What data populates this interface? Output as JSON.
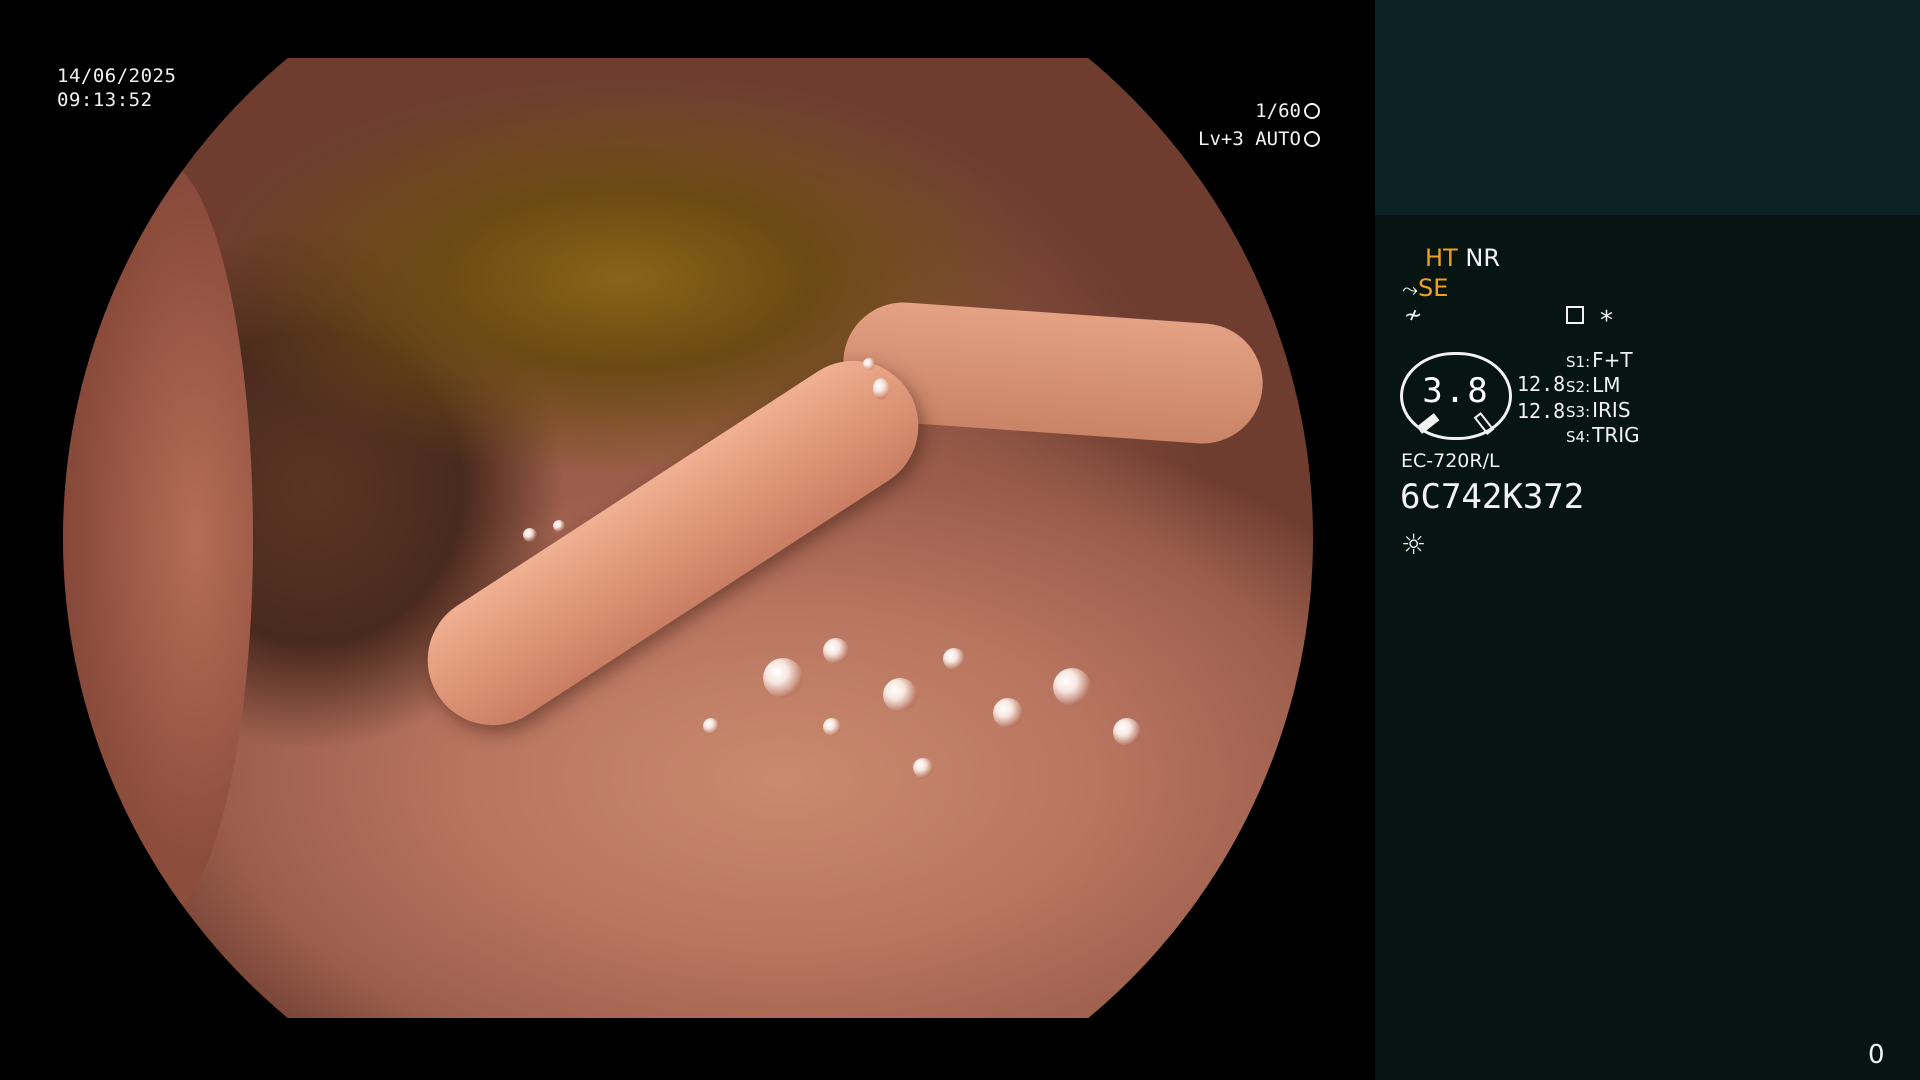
{
  "left": {
    "date": "14/06/2025",
    "time": "09:13:52",
    "shutter": "1/60",
    "exposure": "Lv+3 AUTO",
    "shutter_icon": "shutter-icon",
    "auto_icon": "auto-exposure-icon"
  },
  "panel": {
    "mode_ht": "HT",
    "mode_nr": "NR",
    "se_label": "SE",
    "se_icon": "scope-icon",
    "enhance_icon": "enhance-icon",
    "menu_icon": "menu-icon",
    "star": "*",
    "gauge_value": "3.8",
    "side_values": [
      "12.8",
      "12.8"
    ],
    "settings": [
      {
        "key": "S1:",
        "value": "F+T"
      },
      {
        "key": "S2:",
        "value": "LM"
      },
      {
        "key": "S3:",
        "value": "IRIS"
      },
      {
        "key": "S4:",
        "value": "TRIG"
      }
    ],
    "scope_model": "EC-720R/L",
    "serial": "6C742K372",
    "light_icon": "light-icon",
    "counter": "0"
  }
}
